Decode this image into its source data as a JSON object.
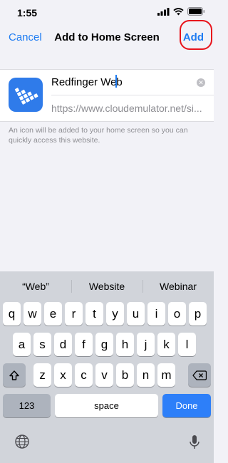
{
  "status_bar": {
    "time": "1:55",
    "icons": [
      "signal-icon",
      "wifi-icon",
      "battery-icon"
    ]
  },
  "nav": {
    "cancel_label": "Cancel",
    "title": "Add to Home Screen",
    "add_label": "Add"
  },
  "shortcut": {
    "app_icon": "redfinger-app-icon",
    "name_value": "Redfinger Web",
    "url": "https://www.cloudemulator.net/si..."
  },
  "info_text": "An icon will be added to your home screen so you can quickly access this website.",
  "keyboard": {
    "suggestions": [
      "“Web”",
      "Website",
      "Webinar"
    ],
    "row1": [
      "q",
      "w",
      "e",
      "r",
      "t",
      "y",
      "u",
      "i",
      "o",
      "p"
    ],
    "row2": [
      "a",
      "s",
      "d",
      "f",
      "g",
      "h",
      "j",
      "k",
      "l"
    ],
    "row3": [
      "z",
      "x",
      "c",
      "v",
      "b",
      "n",
      "m"
    ],
    "numbers_label": "123",
    "space_label": "space",
    "done_label": "Done"
  },
  "colors": {
    "accent": "#1e7cf2",
    "highlight_ring": "#e8131b",
    "done_key": "#2d7ff9"
  }
}
